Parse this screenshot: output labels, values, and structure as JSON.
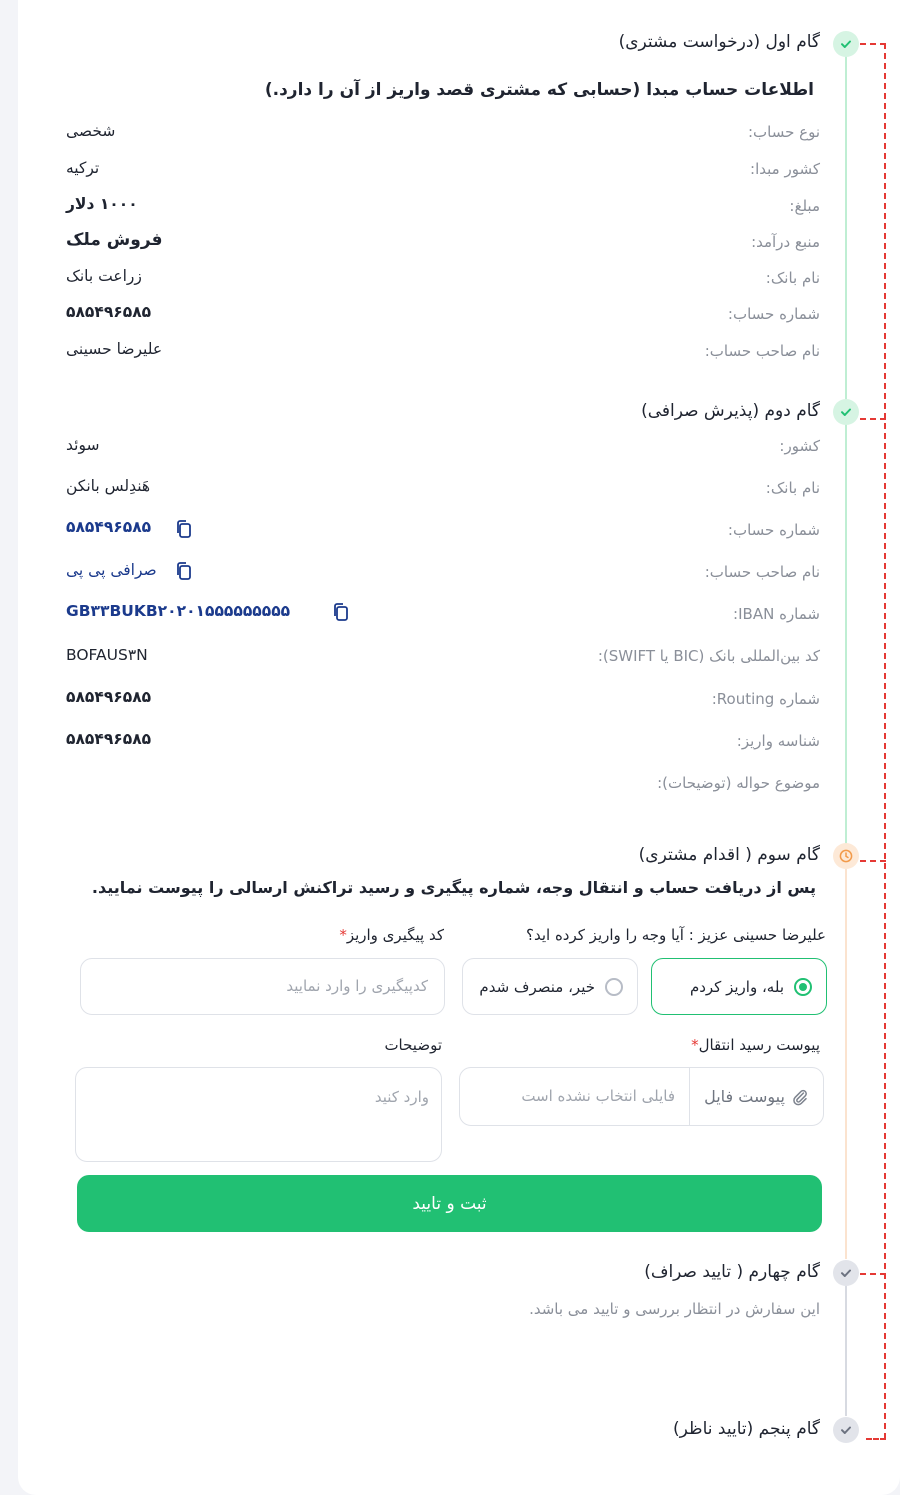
{
  "colors": {
    "accent_green": "#21c073",
    "pending_orange": "#f29a4a",
    "connector_red": "#e53935",
    "link_blue": "#1b3a8c"
  },
  "step1": {
    "title": "گام اول (درخواست مشتری)",
    "subtitle": "اطلاعات حساب مبدا (حسابی که مشتری قصد واریز از آن را دارد.)",
    "rows": [
      {
        "label": "نوع حساب:",
        "value": "شخصی"
      },
      {
        "label": "کشور مبدا:",
        "value": "ترکیه"
      },
      {
        "label": "مبلغ:",
        "value": "۱۰۰۰ دلار"
      },
      {
        "label": "منبع درآمد:",
        "value": "فروش ملک"
      },
      {
        "label": "نام بانک:",
        "value": "زراعت بانک"
      },
      {
        "label": "شماره حساب:",
        "value": "۵۸۵۴۹۶۵۸۵"
      },
      {
        "label": "نام صاحب حساب:",
        "value": "علیرضا حسینی"
      }
    ]
  },
  "step2": {
    "title": "گام دوم (پذیرش صرافی)",
    "rows": [
      {
        "label": "کشور:",
        "value": "سوئد"
      },
      {
        "label": "نام بانک:",
        "value": "هَندِلس بانکن"
      },
      {
        "label": "شماره حساب:",
        "value": "۵۸۵۴۹۶۵۸۵"
      },
      {
        "label": "نام صاحب حساب:",
        "value": "صرافی پی پی"
      },
      {
        "label": "شماره IBAN:",
        "value": "GB۳۳BUKB۲۰۲۰۱۵۵۵۵۵۵۵۵۵"
      },
      {
        "label": "کد بین‌المللی بانک (BIC یا SWIFT):",
        "value": "BOFAUS۳N"
      },
      {
        "label": "شماره Routing:",
        "value": "۵۸۵۴۹۶۵۸۵"
      },
      {
        "label": "شناسه واریز:",
        "value": "۵۸۵۴۹۶۵۸۵"
      },
      {
        "label": "موضوع حواله (توضیحات):",
        "value": ""
      }
    ]
  },
  "step3": {
    "title": "گام سوم ( اقدام مشتری)",
    "instruction": "پس از دریافت حساب و انتقال وجه، شماره پیگیری و رسید تراکنش ارسالی را پیوست نمایید.",
    "question": "علیرضا حسینی عزیز : آیا وجه را واریز کرده اید؟",
    "option_yes": "بله، واریز کردم",
    "option_no": "خیر، منصرف شدم",
    "tracking_label": "کد پیگیری واریز",
    "tracking_placeholder": "کدپیگیری را وارد نمایید",
    "receipt_label": "پیوست رسید انتقال",
    "attach_button": "پیوست فایل",
    "no_file_text": "فایلی انتخاب نشده است",
    "notes_label": "توضیحات",
    "notes_placeholder": "وارد کنید",
    "submit_label": "ثبت و تایید",
    "required_mark": "*"
  },
  "step4": {
    "title": "گام چهارم ( تایید صراف)",
    "note": "این سفارش در انتظار بررسی و تایید می باشد."
  },
  "step5": {
    "title": "گام پنجم (تایید ناظر)"
  }
}
